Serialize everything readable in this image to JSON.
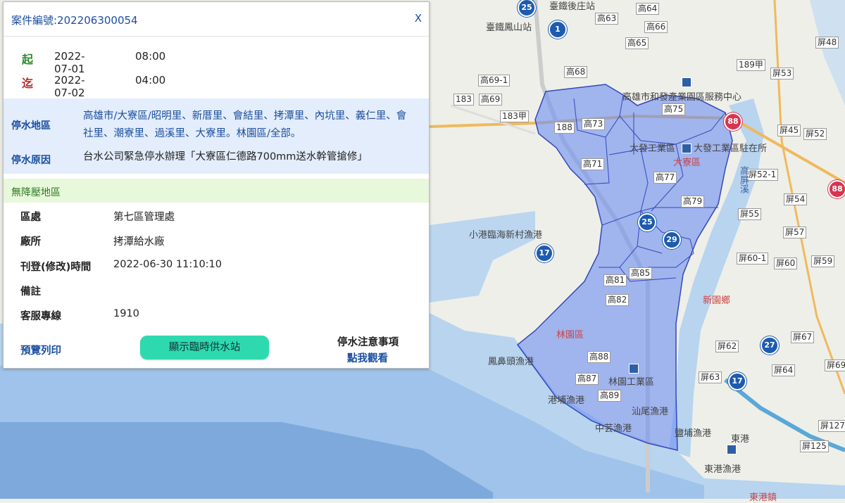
{
  "popup": {
    "case_title": "案件編號:202206300054",
    "close_label": "X",
    "start_label": "起",
    "start_date": "2022-07-01",
    "start_time": "08:00",
    "end_label": "迄",
    "end_date": "2022-07-02",
    "end_time": "04:00",
    "area_label": "停水地區",
    "area_text": "高雄市/大寮區/昭明里、新厝里、會結里、拷潭里、內坑里、義仁里、會社里、潮寮里、過溪里、大寮里。林園區/全部。",
    "reason_label": "停水原因",
    "reason_text": "台水公司緊急停水辦理「大寮區仁德路700mm送水幹管搶修」",
    "no_pressure_label": "無降壓地區",
    "info": [
      {
        "k": "區處",
        "v": "第七區管理處"
      },
      {
        "k": "廠所",
        "v": "拷潭給水廠"
      },
      {
        "k": "刊登(修改)時間",
        "v": "2022-06-30 11:10:10"
      },
      {
        "k": "備註",
        "v": ""
      },
      {
        "k": "客服專線",
        "v": "1910"
      }
    ],
    "print_label": "預覽列印",
    "station_button": "顯示臨時供水站",
    "notice_title": "停水注意事項",
    "notice_link": "點我觀看"
  },
  "map": {
    "labels": [
      "高63",
      "高64",
      "高66",
      "高65",
      "高68",
      "高69-1",
      "高69",
      "183",
      "183甲",
      "188",
      "高73",
      "高71",
      "高75",
      "高77",
      "高79",
      "高81",
      "高82",
      "高85",
      "高87",
      "高88",
      "高89",
      "189甲",
      "屏53",
      "屏45",
      "屏52",
      "屏52-1",
      "屏54",
      "屏55",
      "屏57",
      "屏60-1",
      "屏60",
      "屏59",
      "屏62",
      "屏63",
      "屏64",
      "屏67",
      "屏69",
      "屏48",
      "屏125",
      "屏127"
    ],
    "place_names": [
      "臺鐵後庄站",
      "臺鐵鳳山站",
      "高雄市和發產業園區服務中心",
      "大發工業區",
      "大發工業區駐在所",
      "大寮區",
      "高屏溪",
      "新園鄉",
      "林園區",
      "林園工業區",
      "汕尾漁港",
      "中芸漁港",
      "港埔漁港",
      "鳳鼻頭漁港",
      "小港臨海新村漁港",
      "東港",
      "東港漁港",
      "鹽埔漁港",
      "東港鎮"
    ],
    "shields": [
      "25",
      "1",
      "17",
      "27",
      "17",
      "29",
      "25",
      "88",
      "88"
    ]
  }
}
